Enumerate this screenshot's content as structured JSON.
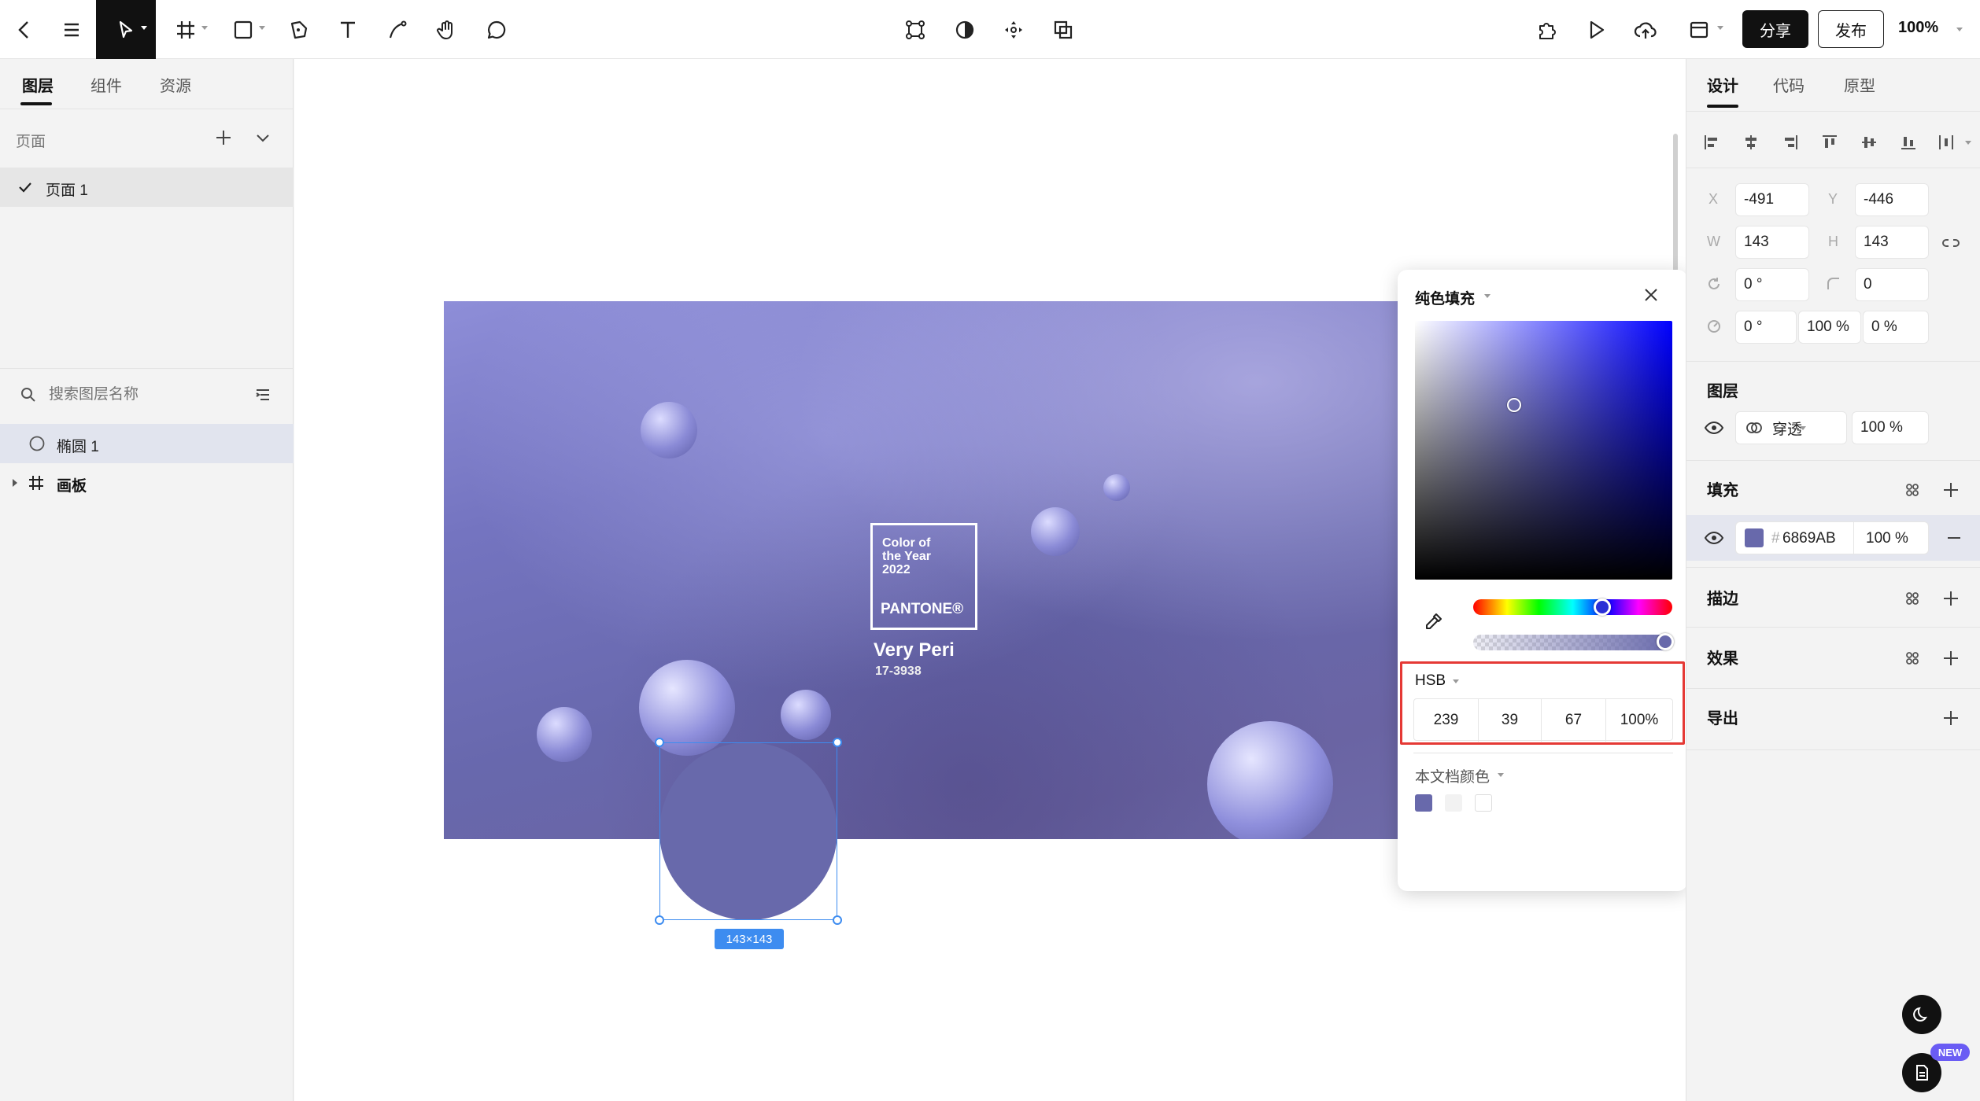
{
  "topbar": {
    "share_label": "分享",
    "publish_label": "发布",
    "zoom": "100%"
  },
  "left": {
    "tabs": [
      "图层",
      "组件",
      "资源"
    ],
    "pages_label": "页面",
    "page_item": "页面 1",
    "search_placeholder": "搜索图层名称",
    "layers": [
      "椭圆 1",
      "画板"
    ]
  },
  "canvas": {
    "pantone_line1": "Color of",
    "pantone_line2": "the Year",
    "pantone_line3": "2022",
    "pantone_brand": "PANTONE®",
    "pantone_name": "Very Peri",
    "pantone_code": "17-3938",
    "size_badge": "143×143"
  },
  "right": {
    "tabs": [
      "设计",
      "代码",
      "原型"
    ],
    "x_label": "X",
    "x_value": "-491",
    "y_label": "Y",
    "y_value": "-446",
    "w_label": "W",
    "w_value": "143",
    "h_label": "H",
    "h_value": "143",
    "rotation": "0 °",
    "radius": "0",
    "skew": "0 °",
    "scale": "100 %",
    "skew2": "0 %",
    "layer_section": "图层",
    "blend_mode": "穿透",
    "layer_opacity": "100 %",
    "fill_section": "填充",
    "fill_hash": "#",
    "fill_hex": "6869AB",
    "fill_opacity": "100 %",
    "stroke_section": "描边",
    "effect_section": "效果",
    "export_section": "导出",
    "new_badge": "NEW"
  },
  "picker": {
    "fill_type": "纯色填充",
    "mode": "HSB",
    "h": "239",
    "s": "39",
    "b": "67",
    "alpha": "100%",
    "doc_colors_label": "本文档颜色"
  },
  "colors": {
    "fill": "#6869AB",
    "selection": "#3d8cf0",
    "highlight": "#e53935"
  }
}
